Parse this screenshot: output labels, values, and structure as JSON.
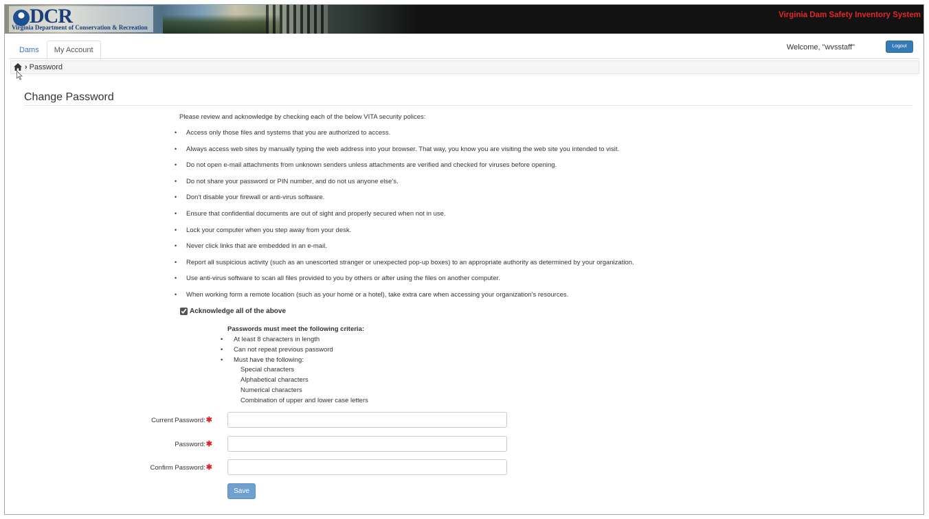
{
  "header": {
    "logo_text": "DCR",
    "logo_subtext": "Virginia Department of Conservation & Recreation",
    "system_title": "Virginia Dam Safety Inventory System"
  },
  "nav": {
    "tabs": [
      {
        "label": "Dams",
        "active": false
      },
      {
        "label": "My Account",
        "active": true
      }
    ],
    "welcome": "Welcome, \"wvsstaff\"",
    "logout_label": "Logout"
  },
  "breadcrumb": {
    "current": "Password"
  },
  "page": {
    "title": "Change Password",
    "intro": "Please review and acknowledge by checking each of the below VITA security polices:",
    "policies": [
      "Access only those files and systems that you are authorized to access.",
      "Always access web sites by manually typing the web address into your browser. That way, you know you are visiting the web site you intended to visit.",
      "Do not open e-mail attachments from unknown senders unless attachments are verified and checked for viruses before opening.",
      "Do not share your password or PIN number, and do not us anyone else's.",
      "Don't disable your firewall or anti-virus software.",
      "Ensure that confidential documents are out of sight and properly secured when not in use.",
      "Lock your computer when you step away from your desk.",
      "Never click links that are embedded in an e-mail.",
      "Report all suspicious activity (such as an unescorted stranger or unexpected pop-up boxes) to an appropriate authority as determined by your organization.",
      "Use anti-virus software to scan all files provided to you by others or after using the files on another computer.",
      "When working form a remote location (such as your home or a hotel), take extra care when accessing your organization's resources."
    ],
    "acknowledge_label": "Acknowledge all of the above",
    "acknowledge_checked": true,
    "criteria": {
      "title": "Passwords must meet the following criteria:",
      "items": [
        "At least 8 characters in length",
        "Can not repeat previous password",
        "Must have the following:"
      ],
      "sub_items": [
        "Special characters",
        "Alphabetical characters",
        "Numerical characters",
        "Combination of upper and lower case letters"
      ]
    },
    "form": {
      "current_password_label": "Current Password:",
      "password_label": "Password:",
      "confirm_password_label": "Confirm Password:",
      "current_password_value": "",
      "password_value": "",
      "confirm_password_value": "",
      "save_label": "Save"
    }
  },
  "colors": {
    "accent": "#337ab7",
    "required": "#d9262c",
    "system_title": "#e32629"
  }
}
